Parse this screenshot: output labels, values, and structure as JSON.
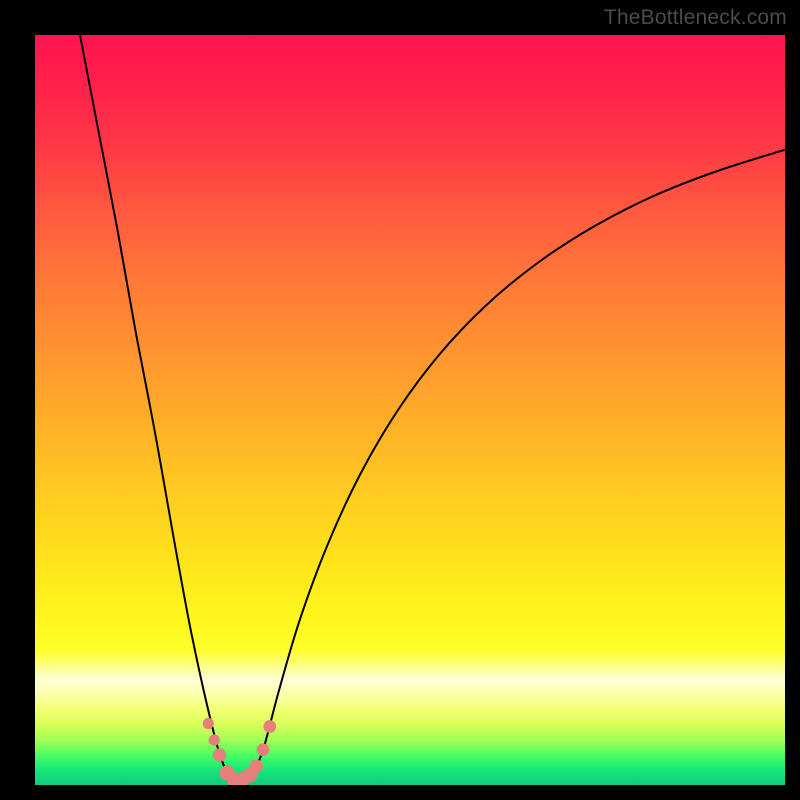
{
  "watermark": "TheBottleneck.com",
  "colors": {
    "frame": "#000000",
    "curve_stroke": "#000000",
    "marker_fill": "#e57f7c",
    "watermark_text": "#4b4b4b"
  },
  "chart_data": {
    "type": "line",
    "title": "",
    "xlabel": "",
    "ylabel": "",
    "xlim": [
      0,
      100
    ],
    "ylim": [
      0,
      100
    ],
    "grid": false,
    "legend": false,
    "series": [
      {
        "name": "bottleneck-v-curve",
        "note": "Screen-space path (0-100): y=0 is top, y≈100 is bottom. Minimum (green zone) near x≈27, curve rises steeply left to top and more gradually to upper-right.",
        "points": [
          {
            "x": 6.0,
            "y": 0.0
          },
          {
            "x": 8.5,
            "y": 13.0
          },
          {
            "x": 11.0,
            "y": 26.0
          },
          {
            "x": 13.5,
            "y": 40.0
          },
          {
            "x": 16.0,
            "y": 53.0
          },
          {
            "x": 18.3,
            "y": 66.0
          },
          {
            "x": 20.5,
            "y": 78.0
          },
          {
            "x": 22.4,
            "y": 87.0
          },
          {
            "x": 24.3,
            "y": 94.8
          },
          {
            "x": 25.3,
            "y": 97.7
          },
          {
            "x": 25.9,
            "y": 98.8
          },
          {
            "x": 26.4,
            "y": 99.3
          },
          {
            "x": 27.0,
            "y": 99.45
          },
          {
            "x": 27.6,
            "y": 99.45
          },
          {
            "x": 28.2,
            "y": 99.3
          },
          {
            "x": 28.8,
            "y": 98.8
          },
          {
            "x": 29.4,
            "y": 97.9
          },
          {
            "x": 30.6,
            "y": 94.7
          },
          {
            "x": 32.5,
            "y": 87.5
          },
          {
            "x": 35.3,
            "y": 78.0
          },
          {
            "x": 39.0,
            "y": 68.0
          },
          {
            "x": 43.4,
            "y": 58.5
          },
          {
            "x": 48.4,
            "y": 50.0
          },
          {
            "x": 54.0,
            "y": 42.5
          },
          {
            "x": 60.2,
            "y": 36.0
          },
          {
            "x": 67.0,
            "y": 30.4
          },
          {
            "x": 74.4,
            "y": 25.6
          },
          {
            "x": 82.4,
            "y": 21.5
          },
          {
            "x": 90.8,
            "y": 18.2
          },
          {
            "x": 100.0,
            "y": 15.3
          }
        ]
      }
    ],
    "markers": {
      "name": "bottom-dots",
      "note": "Pink/coral circular markers clustered at curve minimum (green band).",
      "points": [
        {
          "x": 23.1,
          "y": 91.8,
          "r": 0.75
        },
        {
          "x": 23.9,
          "y": 94.0,
          "r": 0.75
        },
        {
          "x": 24.6,
          "y": 96.0,
          "r": 0.9
        },
        {
          "x": 25.6,
          "y": 98.4,
          "r": 1.0
        },
        {
          "x": 26.6,
          "y": 99.3,
          "r": 1.0
        },
        {
          "x": 27.6,
          "y": 99.3,
          "r": 1.0
        },
        {
          "x": 28.6,
          "y": 98.7,
          "r": 1.0
        },
        {
          "x": 29.5,
          "y": 97.5,
          "r": 0.9
        },
        {
          "x": 30.4,
          "y": 95.3,
          "r": 0.85
        },
        {
          "x": 31.3,
          "y": 92.2,
          "r": 0.85
        }
      ]
    }
  }
}
